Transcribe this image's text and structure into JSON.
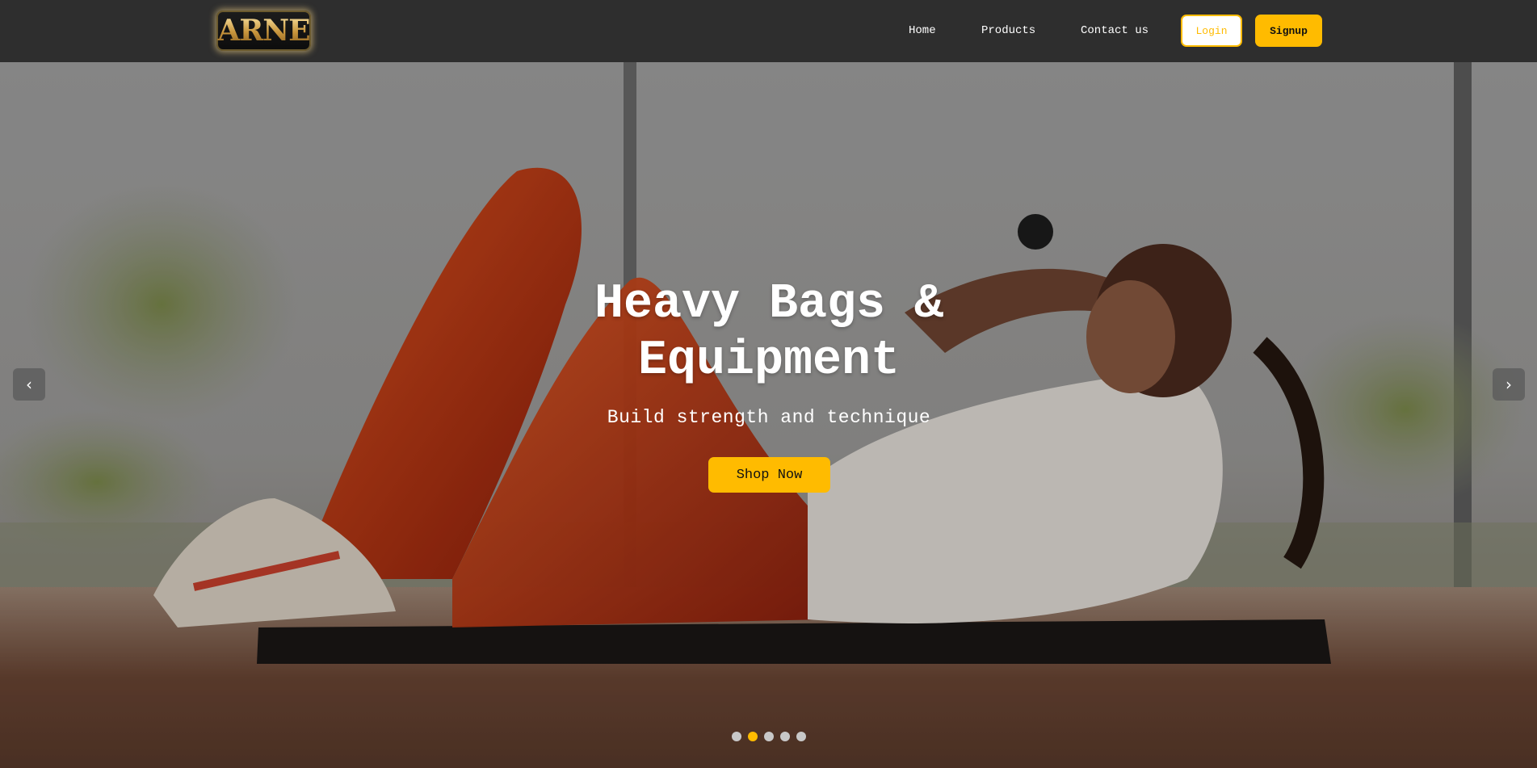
{
  "navbar": {
    "logo_text": "ARNE",
    "links": [
      {
        "label": "Home"
      },
      {
        "label": "Products"
      },
      {
        "label": "Contact us"
      }
    ],
    "login_label": "Login",
    "signup_label": "Signup"
  },
  "hero": {
    "title": "Heavy Bags & Equipment",
    "subtitle": "Build strength and technique",
    "cta_label": "Shop Now",
    "prev_arrow": "‹",
    "next_arrow": "›",
    "slide_count": 5,
    "active_slide": 2
  },
  "colors": {
    "accent": "#ffbb00",
    "navbar_bg": "#2e2e2e",
    "text_light": "#ffffff"
  },
  "icons": {
    "prev": "chevron-left-icon",
    "next": "chevron-right-icon"
  }
}
